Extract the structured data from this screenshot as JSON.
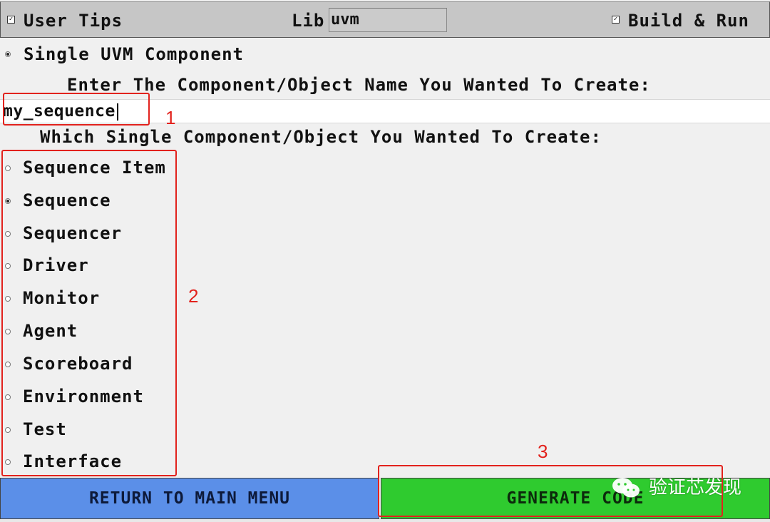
{
  "topbar": {
    "user_tips_label": "User Tips",
    "user_tips_checked": true,
    "lib_label": "Lib",
    "lib_value": "uvm",
    "build_run_label": "Build & Run",
    "build_run_checked": true
  },
  "mode": {
    "label": "Single UVM Component",
    "selected": true
  },
  "name_prompt": "Enter The Component/Object Name You Wanted To Create:",
  "name_value": "my_sequence",
  "type_prompt": "Which Single Component/Object You Wanted To Create:",
  "options": [
    {
      "label": "Sequence Item",
      "selected": false
    },
    {
      "label": "Sequence",
      "selected": true
    },
    {
      "label": "Sequencer",
      "selected": false
    },
    {
      "label": "Driver",
      "selected": false
    },
    {
      "label": "Monitor",
      "selected": false
    },
    {
      "label": "Agent",
      "selected": false
    },
    {
      "label": "Scoreboard",
      "selected": false
    },
    {
      "label": "Environment",
      "selected": false
    },
    {
      "label": "Test",
      "selected": false
    },
    {
      "label": "Interface",
      "selected": false
    }
  ],
  "buttons": {
    "return_label": "RETURN TO MAIN MENU",
    "generate_label": "GENERATE CODE"
  },
  "annotations": {
    "marker_1": "1",
    "marker_2": "2",
    "marker_3": "3",
    "color": "#e2221d"
  },
  "watermark": {
    "text": "验证芯发现",
    "icon": "wechat-icon"
  },
  "colors": {
    "return_button": "#5b8fe8",
    "generate_button": "#2fcb2f",
    "topbar": "#c6c6c6"
  }
}
